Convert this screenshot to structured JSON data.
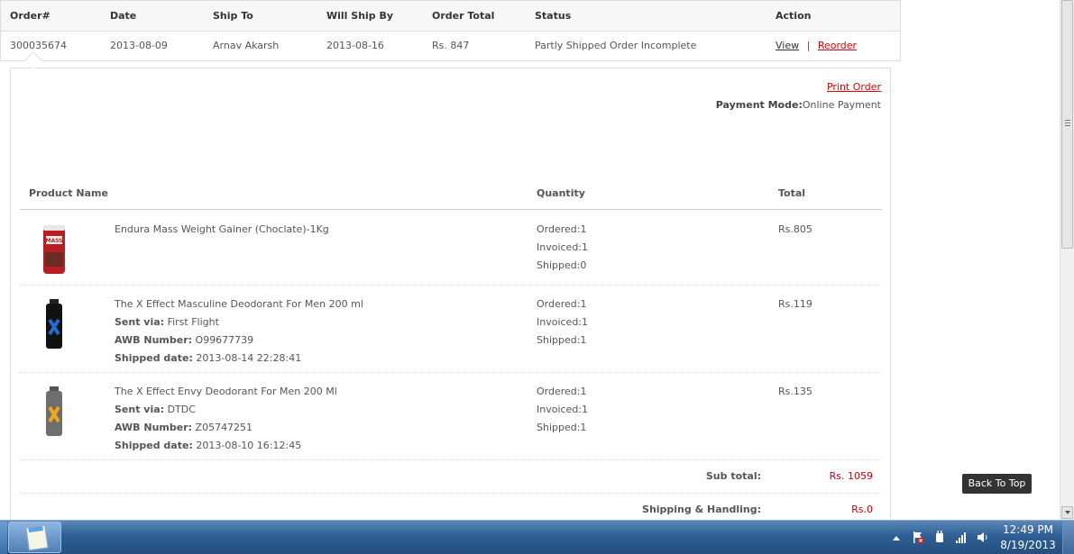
{
  "order_table": {
    "headers": [
      "Order#",
      "Date",
      "Ship To",
      "Will Ship By",
      "Order Total",
      "Status",
      "Action"
    ],
    "row": {
      "order_no": "300035674",
      "date": "2013-08-09",
      "ship_to": "Arnav Akarsh",
      "will_ship_by": "2013-08-16",
      "order_total": "Rs. 847",
      "status": "Partly Shipped Order Incomplete",
      "view_label": "View",
      "separator": "|",
      "reorder_label": "Reorder"
    }
  },
  "detail": {
    "print_order": "Print Order",
    "payment_mode_label": "Payment Mode:",
    "payment_mode_value": "Online Payment",
    "headers": {
      "product": "Product Name",
      "quantity": "Quantity",
      "total": "Total"
    },
    "labels": {
      "sent_via": "Sent via:",
      "awb": "AWB Number:",
      "shipped_date": "Shipped date:"
    },
    "products": [
      {
        "name": "Endura Mass Weight Gainer (Choclate)-1Kg",
        "ordered": "Ordered:1",
        "invoiced": "Invoiced:1",
        "shipped": "Shipped:0",
        "total": "Rs.805"
      },
      {
        "name": "The X Effect Masculine Deodorant For Men 200 ml",
        "sent_via": "First Flight",
        "awb": "O99677739",
        "shipped_date": "2013-08-14 22:28:41",
        "ordered": "Ordered:1",
        "invoiced": "Invoiced:1",
        "shipped": "Shipped:1",
        "total": "Rs.119"
      },
      {
        "name": "The X Effect Envy Deodorant For Men 200 Ml",
        "sent_via": "DTDC",
        "awb": "Z05747251",
        "shipped_date": "2013-08-10 16:12:45",
        "ordered": "Ordered:1",
        "invoiced": "Invoiced:1",
        "shipped": "Shipped:1",
        "total": "Rs.135"
      }
    ],
    "summary": {
      "subtotal_label": "Sub total:",
      "subtotal_value": "Rs. 1059",
      "shipping_label": "Shipping & Handling:",
      "shipping_value": "Rs.0"
    }
  },
  "back_to_top": "Back To Top",
  "taskbar": {
    "time": "12:49 PM",
    "date": "8/19/2013"
  },
  "colors": {
    "link_red": "#dd0000",
    "price_red": "#cc0000",
    "taskbar_blue": "#2f5f94"
  }
}
